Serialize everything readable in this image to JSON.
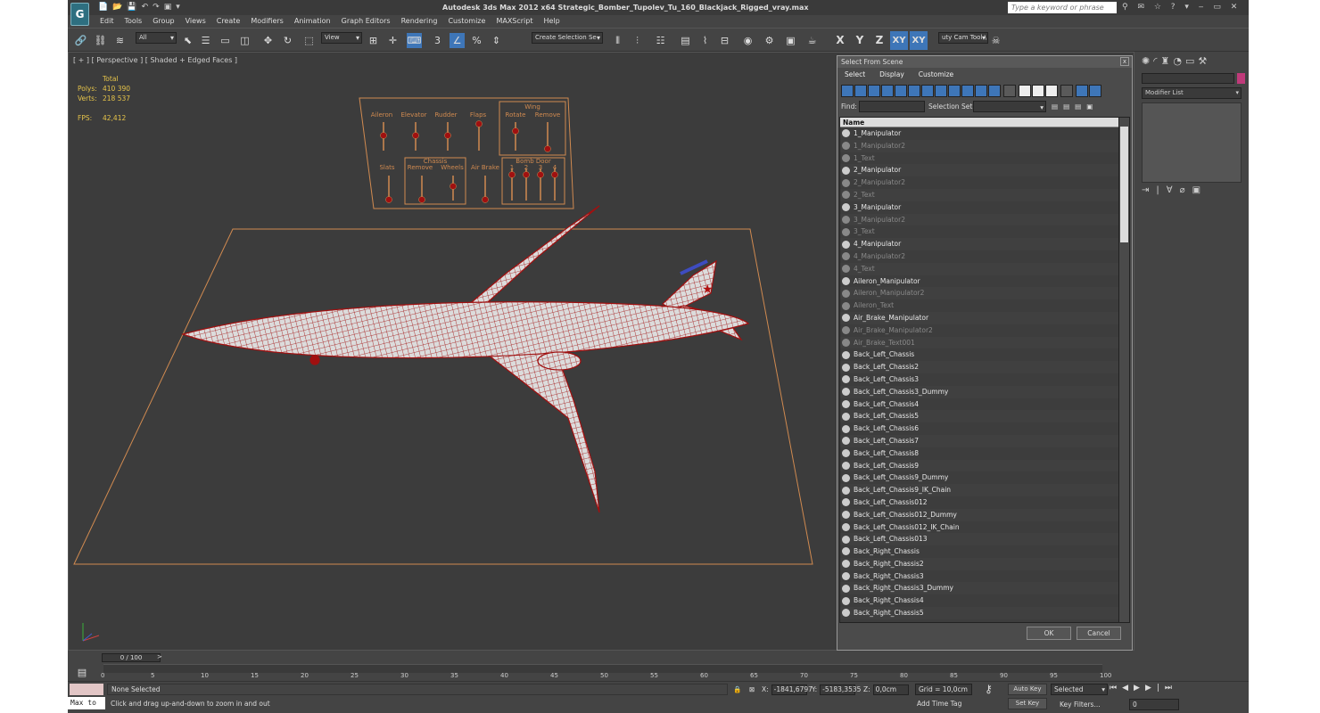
{
  "app": {
    "logo": "G",
    "title": "Autodesk 3ds Max  2012 x64      Strategic_Bomber_Tupolev_Tu_160_Blackjack_Rigged_vray.max",
    "search_placeholder": "Type a keyword or phrase"
  },
  "menu": [
    "Edit",
    "Tools",
    "Group",
    "Views",
    "Create",
    "Modifiers",
    "Animation",
    "Graph Editors",
    "Rendering",
    "Customize",
    "MAXScript",
    "Help"
  ],
  "toolbar": {
    "filter": "All",
    "refcoord": "View",
    "snap_label": "3",
    "selection_set": "Create Selection Se",
    "axes": [
      "X",
      "Y",
      "Z",
      "XY",
      "XY"
    ],
    "cam_tool": "uty Cam Tool \\"
  },
  "viewport": {
    "label": "[ + ] [ Perspective ] [ Shaded + Edged Faces ]",
    "stats": {
      "total": "Total",
      "polys_k": "Polys:",
      "polys_v": "410 390",
      "verts_k": "Verts:",
      "verts_v": "218 537",
      "fps_k": "FPS:",
      "fps_v": "42,412"
    },
    "rig": {
      "top": [
        "Aileron",
        "Elevator",
        "Rudder",
        "Flaps"
      ],
      "wing": "Wing",
      "wing_sub": [
        "Rotate",
        "Remove"
      ],
      "bottom_slats": "Slats",
      "chassis": "Chassis",
      "chassis_sub": [
        "Remove",
        "Wheels"
      ],
      "airbrake": "Air Brake",
      "bombdoor": "Bomb Door",
      "bombdoor_sub": [
        "1",
        "2",
        "3",
        "4"
      ]
    }
  },
  "dialog": {
    "title": "Select From Scene",
    "close": "x",
    "menu": [
      "Select",
      "Display",
      "Customize"
    ],
    "find_label": "Find:",
    "selset_label": "Selection Set:",
    "list_header": "Name",
    "items": [
      {
        "name": "1_Manipulator",
        "dim": false
      },
      {
        "name": "1_Manipulator2",
        "dim": true
      },
      {
        "name": "1_Text",
        "dim": true
      },
      {
        "name": "2_Manipulator",
        "dim": false
      },
      {
        "name": "2_Manipulator2",
        "dim": true
      },
      {
        "name": "2_Text",
        "dim": true
      },
      {
        "name": "3_Manipulator",
        "dim": false
      },
      {
        "name": "3_Manipulator2",
        "dim": true
      },
      {
        "name": "3_Text",
        "dim": true
      },
      {
        "name": "4_Manipulator",
        "dim": false
      },
      {
        "name": "4_Manipulator2",
        "dim": true
      },
      {
        "name": "4_Text",
        "dim": true
      },
      {
        "name": "Aileron_Manipulator",
        "dim": false
      },
      {
        "name": "Aileron_Manipulator2",
        "dim": true
      },
      {
        "name": "Aileron_Text",
        "dim": true
      },
      {
        "name": "Air_Brake_Manipulator",
        "dim": false
      },
      {
        "name": "Air_Brake_Manipulator2",
        "dim": true
      },
      {
        "name": "Air_Brake_Text001",
        "dim": true
      },
      {
        "name": "Back_Left_Chassis",
        "dim": false
      },
      {
        "name": "Back_Left_Chassis2",
        "dim": false
      },
      {
        "name": "Back_Left_Chassis3",
        "dim": false
      },
      {
        "name": "Back_Left_Chassis3_Dummy",
        "dim": false
      },
      {
        "name": "Back_Left_Chassis4",
        "dim": false
      },
      {
        "name": "Back_Left_Chassis5",
        "dim": false
      },
      {
        "name": "Back_Left_Chassis6",
        "dim": false
      },
      {
        "name": "Back_Left_Chassis7",
        "dim": false
      },
      {
        "name": "Back_Left_Chassis8",
        "dim": false
      },
      {
        "name": "Back_Left_Chassis9",
        "dim": false
      },
      {
        "name": "Back_Left_Chassis9_Dummy",
        "dim": false
      },
      {
        "name": "Back_Left_Chassis9_IK_Chain",
        "dim": false
      },
      {
        "name": "Back_Left_Chassis012",
        "dim": false
      },
      {
        "name": "Back_Left_Chassis012_Dummy",
        "dim": false
      },
      {
        "name": "Back_Left_Chassis012_IK_Chain",
        "dim": false
      },
      {
        "name": "Back_Left_Chassis013",
        "dim": false
      },
      {
        "name": "Back_Right_Chassis",
        "dim": false
      },
      {
        "name": "Back_Right_Chassis2",
        "dim": false
      },
      {
        "name": "Back_Right_Chassis3",
        "dim": false
      },
      {
        "name": "Back_Right_Chassis3_Dummy",
        "dim": false
      },
      {
        "name": "Back_Right_Chassis4",
        "dim": false
      },
      {
        "name": "Back_Right_Chassis5",
        "dim": false
      }
    ],
    "ok": "OK",
    "cancel": "Cancel"
  },
  "command_panel": {
    "modifier_list": "Modifier List",
    "color": "#c03a7a"
  },
  "timeline": {
    "slider": "0 / 100",
    "arrow": ">",
    "ticks": [
      "0",
      "5",
      "10",
      "15",
      "20",
      "25",
      "30",
      "35",
      "40",
      "45",
      "50",
      "55",
      "60",
      "65",
      "70",
      "75",
      "80",
      "85",
      "90",
      "95",
      "100"
    ]
  },
  "status": {
    "selection": "None Selected",
    "hint": "Click and drag up-and-down to zoom in and out",
    "maxscript": "Max to",
    "x_label": "X:",
    "x": "-1841,6797",
    "y_label": "Y:",
    "y": "-5183,3535",
    "z_label": "Z:",
    "z": "0,0cm",
    "grid": "Grid = 10,0cm",
    "add_time_tag": "Add Time Tag",
    "auto_key": "Auto Key",
    "set_key": "Set Key",
    "key_mode": "Selected",
    "key_filters": "Key Filters...",
    "frame": "0"
  },
  "colors": {
    "accent": "#3e76b8",
    "wire": "#a01010",
    "grid_frame": "#d08a50",
    "rig": "#d08a50"
  }
}
